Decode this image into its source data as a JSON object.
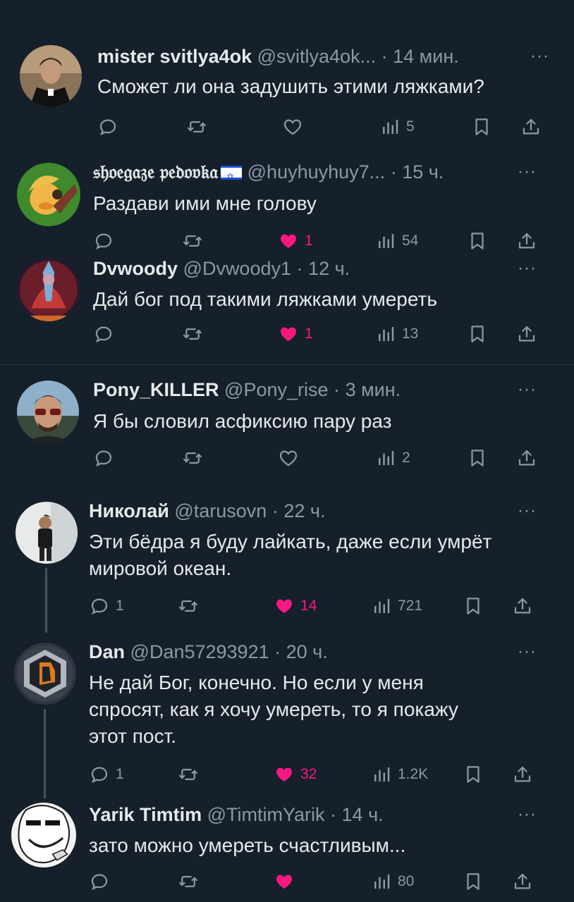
{
  "tweets": [
    {
      "name": "mister svitlya4ok",
      "handle": "@svitlya4ok...",
      "time": "14 мин.",
      "text": "Сможет ли она задушить этими ляжками?",
      "replies": "",
      "likes": "",
      "liked": false,
      "views": "5"
    },
    {
      "name": "𝔰𝔥𝔬𝔢𝔤𝔞𝔷𝔢 𝔭𝔢𝔡𝔬𝔳𝔨𝔞",
      "handle": "@huyhuyhuy7...",
      "time": "15 ч.",
      "text": "Раздави ими мне голову",
      "replies": "",
      "likes": "1",
      "liked": true,
      "views": "54"
    },
    {
      "name": "Dvwoody",
      "handle": "@Dvwoody1",
      "time": "12 ч.",
      "text": "Дай бог под такими ляжками умереть",
      "replies": "",
      "likes": "1",
      "liked": true,
      "views": "13"
    },
    {
      "name": "Pony_KILLER",
      "handle": "@Pony_rise",
      "time": "3 мин.",
      "text": "Я бы словил асфиксию пару раз",
      "replies": "",
      "likes": "",
      "liked": false,
      "views": "2"
    },
    {
      "name": "Николай",
      "handle": "@tarusovn",
      "time": "22 ч.",
      "text": "Эти бёдра я буду лайкать, даже если умрёт\nмировой океан.",
      "replies": "1",
      "likes": "14",
      "liked": true,
      "views": "721"
    },
    {
      "name": "Dan",
      "handle": "@Dan57293921",
      "time": "20 ч.",
      "text": "Не дай Бог, конечно. Но если у меня\nспросят, как я хочу умереть, то я покажу\nэтот пост.",
      "replies": "1",
      "likes": "32",
      "liked": true,
      "views": "1.2K"
    },
    {
      "name": "Yarik Timtim",
      "handle": "@TimtimYarik",
      "time": "14 ч.",
      "text": "зато можно умереть счастливым...",
      "replies": "",
      "likes": "",
      "liked": true,
      "views": "80"
    }
  ],
  "ui": {
    "dot": "·",
    "more": "···",
    "icons": [
      "reply-icon",
      "retweet-icon",
      "like-icon",
      "views-icon",
      "bookmark-icon",
      "share-icon"
    ],
    "colors": {
      "background": "#15202b",
      "like": "#f91880",
      "muted": "#8b98a5",
      "text": "#e7e9ea"
    }
  }
}
